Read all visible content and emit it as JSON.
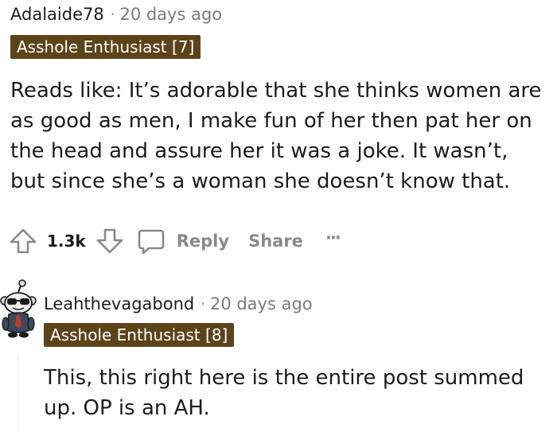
{
  "comments": [
    {
      "author": "Adalaide78",
      "separator": "·",
      "time": "20 days ago",
      "flair": "Asshole Enthusiast [7]",
      "body": "Reads like: It’s adorable that she thinks women are as good as men, I make fun of her then pat her on the head and assure her it was a joke. It wasn’t, but since she’s a woman she doesn’t know that.",
      "actions": {
        "score": "1.3k",
        "reply_label": "Reply",
        "share_label": "Share",
        "more_label": "···"
      }
    },
    {
      "author": "Leahthevagabond",
      "separator": "·",
      "time": "20 days ago",
      "flair": "Asshole Enthusiast [8]",
      "body": "This, this right here is the entire post summed up. OP is an AH."
    }
  ],
  "colors": {
    "flair_bg": "#5c4419",
    "meta_gray": "#787c7e",
    "action_gray": "#878a8c",
    "text": "#1c1c1c"
  },
  "icons": [
    "upvote-icon",
    "downvote-icon",
    "comment-bubble-icon",
    "more-icon",
    "snoo-avatar-icon"
  ]
}
